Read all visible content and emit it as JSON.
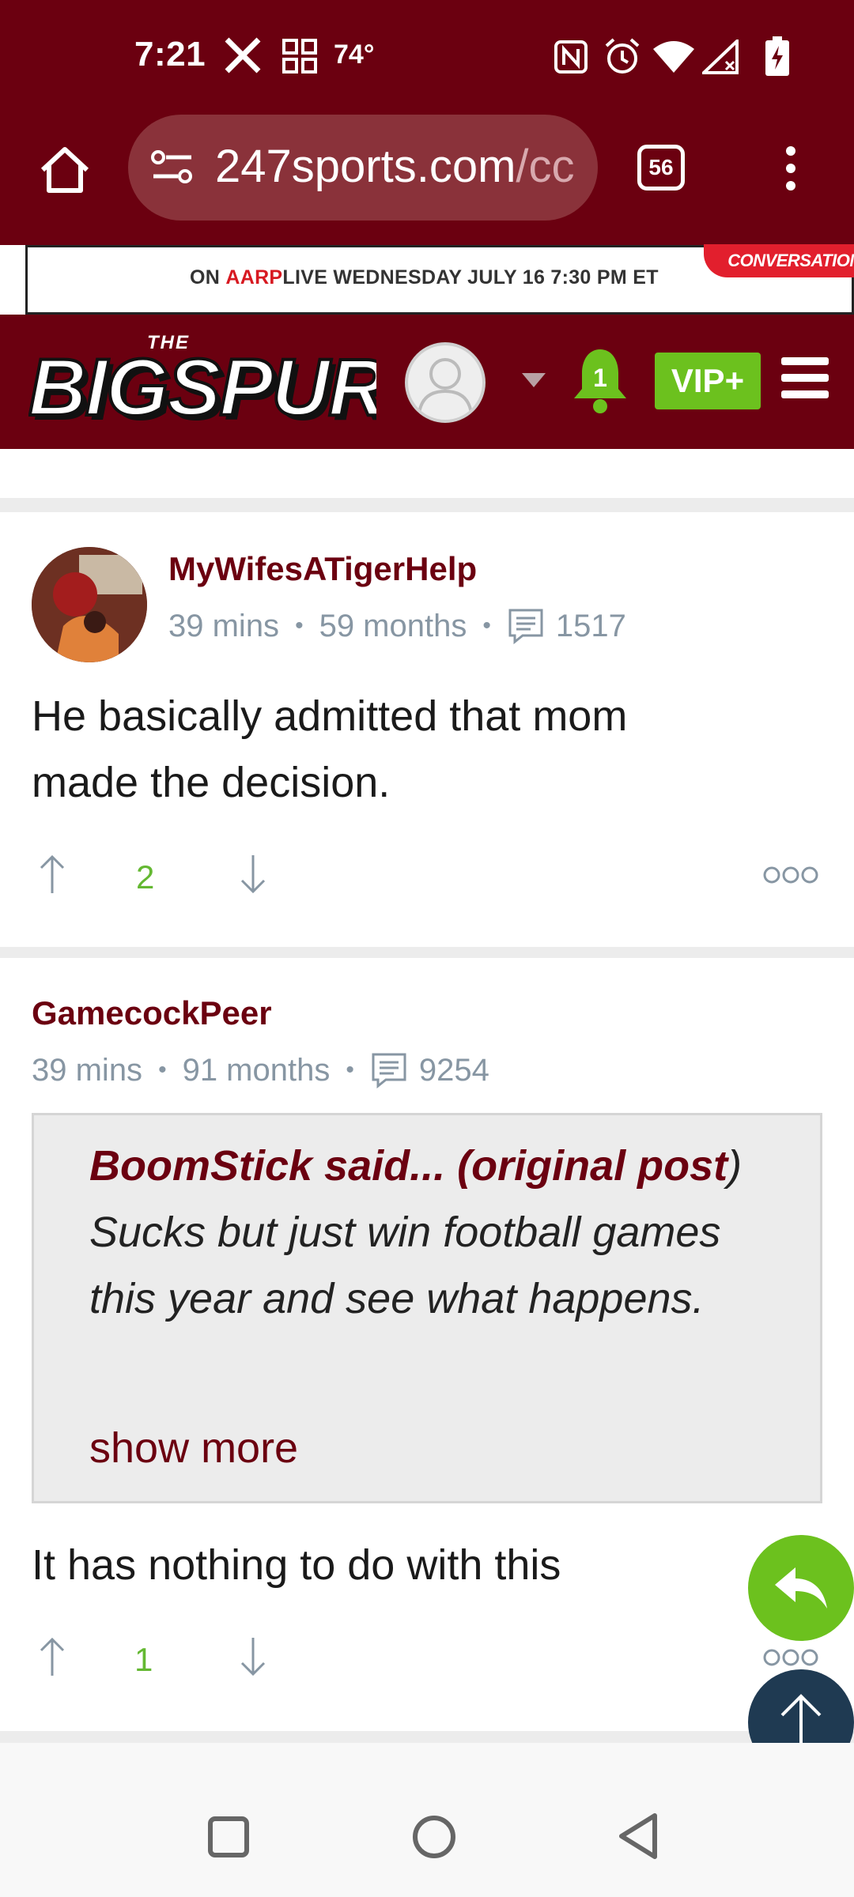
{
  "status_bar": {
    "time": "7:21",
    "temperature": "74°",
    "icons": [
      "x-app-icon",
      "widgets-icon",
      "nfc-icon",
      "alarm-icon",
      "wifi-icon",
      "signal-icon",
      "battery-icon"
    ]
  },
  "browser": {
    "url_domain": "247sports.com",
    "url_rest": "/cc",
    "tab_count": "56",
    "icons": [
      "home-icon",
      "site-info-icon",
      "tabs-icon",
      "more-vert-icon"
    ]
  },
  "ad": {
    "text_prefix": "ON ",
    "aarp": "AARP",
    "live": "LIVE",
    "text_suffix": " WEDNESDAY JULY 16 7:30 PM ET",
    "badge": "CONVERSATION"
  },
  "site_header": {
    "logo_the": "THE",
    "logo_text": "BIGSPUR",
    "notification_count": "1",
    "vip_label": "VIP+"
  },
  "posts": [
    {
      "username": "MyWifesATigerHelp",
      "time_ago": "39 mins",
      "tenure": "59 months",
      "post_count": "1517",
      "body": "He basically admitted that mom made the decision.",
      "votes": "2"
    },
    {
      "username": "GamecockPeer",
      "time_ago": "39 mins",
      "tenure": "91 months",
      "post_count": "9254",
      "quote_author": "BoomStick said... (original post",
      "quote_body": ") Sucks but just win football games this year and see what happens.",
      "show_more": "show more",
      "body": "It has nothing to do with this",
      "votes": "1"
    }
  ],
  "colors": {
    "brand": "#6b0010",
    "accent_green": "#6cc11e",
    "meta_gray": "#8796a3",
    "fab_dark": "#1f3a52"
  }
}
